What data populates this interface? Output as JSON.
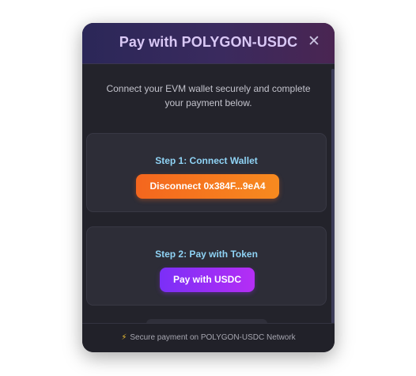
{
  "modal": {
    "title": "Pay with POLYGON-USDC",
    "close_icon": "close-icon",
    "intro": "Connect your EVM wallet securely and complete your payment below."
  },
  "step1": {
    "title": "Step 1: Connect Wallet",
    "button_label": "Disconnect 0x384F...9eA4"
  },
  "step2": {
    "title": "Step 2: Pay with Token",
    "button_label": "Pay with USDC"
  },
  "footer": {
    "icon": "bolt-icon",
    "text": "Secure payment on POLYGON-USDC Network"
  },
  "colors": {
    "accent_orange": "#f4661e",
    "accent_purple": "#7b2ff7",
    "step_title": "#8fd3f5",
    "header_title": "#d9c8f5"
  }
}
